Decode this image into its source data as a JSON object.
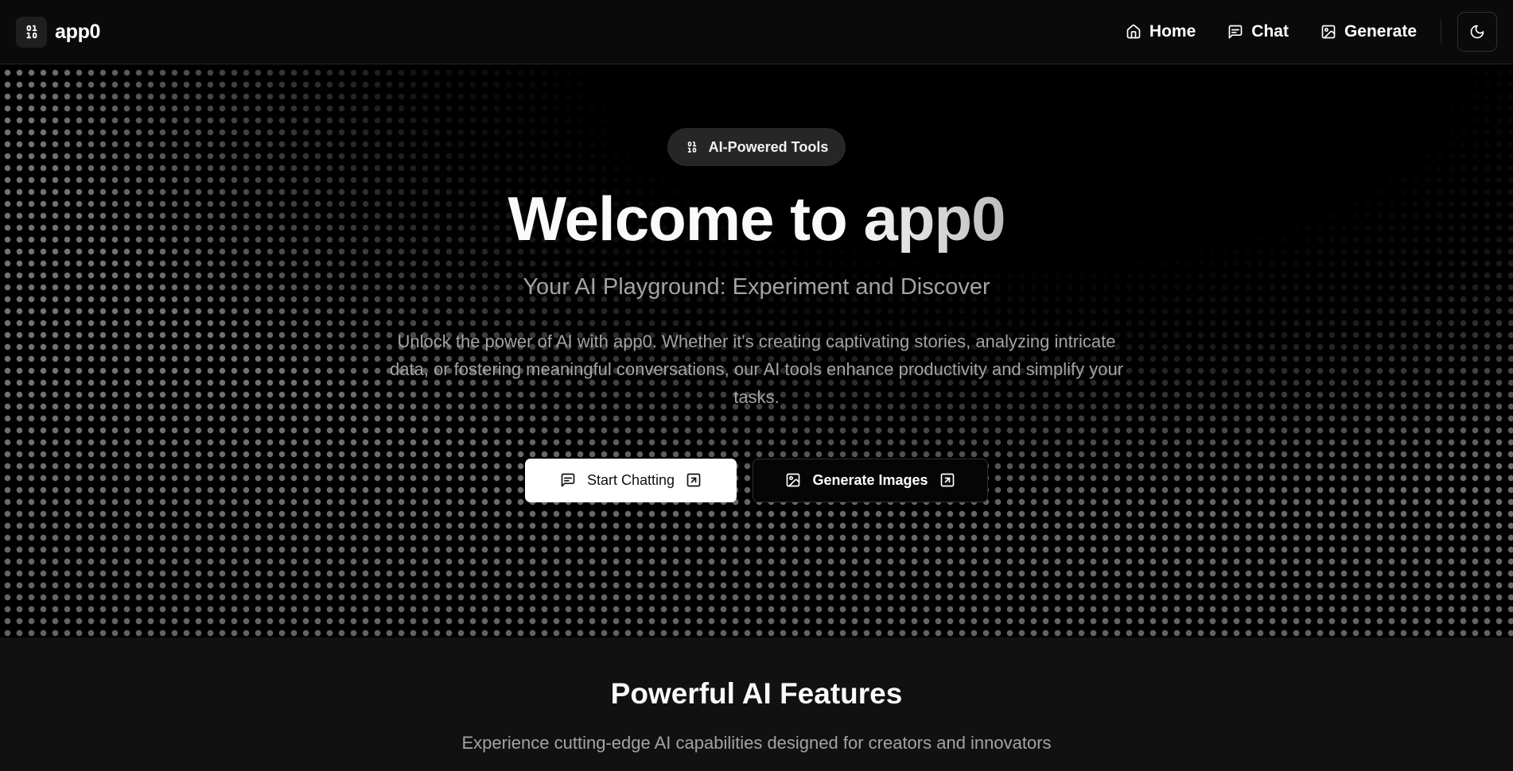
{
  "header": {
    "brand_name": "app0",
    "nav": [
      {
        "label": "Home",
        "icon": "home-icon"
      },
      {
        "label": "Chat",
        "icon": "message-icon"
      },
      {
        "label": "Generate",
        "icon": "image-icon"
      }
    ],
    "theme_toggle_icon": "moon-icon"
  },
  "hero": {
    "badge": "AI-Powered Tools",
    "title_part1": "Welcome to ",
    "title_part2": "app0",
    "subtitle": "Your AI Playground: Experiment and Discover",
    "description": "Unlock the power of AI with app0. Whether it's creating captivating stories, analyzing intricate data, or fostering meaningful conversations, our AI tools enhance productivity and simplify your tasks.",
    "primary_button": "Start Chatting",
    "secondary_button": "Generate Images"
  },
  "features": {
    "title": "Powerful AI Features",
    "subtitle": "Experience cutting-edge AI capabilities designed for creators and innovators"
  },
  "colors": {
    "background": "#000000",
    "header_bg": "#0a0a0a",
    "section_bg": "#111111",
    "muted_text": "#a3a3a3"
  }
}
